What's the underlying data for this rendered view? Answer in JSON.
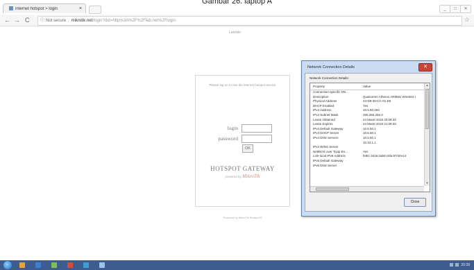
{
  "caption": "Gambar 26. laptop A",
  "browser": {
    "tab_title": "internet hotspot > login",
    "tab_close": "×",
    "back_icon": "←",
    "forward_icon": "→",
    "reload_icon": "C",
    "not_secure": "Not secure",
    "url_host": "mikrotik.net",
    "url_path": "/login?dst=http%3A%2F%2Flab.net%2Flogin",
    "star_icon": "☆",
    "win_min": "_",
    "win_max": "□",
    "win_close": "✕"
  },
  "hotspot": {
    "language_link": "Latviski",
    "notice": "Please log on to use the internet hotspot service",
    "login_label": "login",
    "password_label": "password",
    "ok_button": "OK",
    "brand": "HOTSPOT GATEWAY",
    "powered_by": "powered by",
    "mikrotik": "MikroTik",
    "footer": "Powered by MikroTik RouterOS"
  },
  "dialog": {
    "title": "Network Connection Details",
    "close_icon": "✕",
    "subtitle": "Network Connection Details:",
    "col_property": "Property",
    "col_value": "Value",
    "rows": [
      {
        "p": "Connection-specific DN...",
        "v": ""
      },
      {
        "p": "Description",
        "v": "Qualcomm Atheros AR956x Wireless I"
      },
      {
        "p": "Physical Address",
        "v": "44-D9-30-CC-01-E6"
      },
      {
        "p": "DHCP Enabled",
        "v": "Yes"
      },
      {
        "p": "IPv4 Address",
        "v": "10.5.50.253"
      },
      {
        "p": "IPv4 Subnet Mask",
        "v": "255.255.255.0"
      },
      {
        "p": "Lease Obtained",
        "v": "24 Maret 2018 20:09:33"
      },
      {
        "p": "Lease Expires",
        "v": "24 Maret 2018 21:09:33"
      },
      {
        "p": "IPv4 Default Gateway",
        "v": "10.5.50.1"
      },
      {
        "p": "IPv4 DHCP Server",
        "v": "10.5.50.1"
      },
      {
        "p": "IPv4 DNS Servers",
        "v": "10.5.50.1"
      },
      {
        "p": "",
        "v": "10.10.1.1"
      },
      {
        "p": "IPv4 WINS Server",
        "v": ""
      },
      {
        "p": "NetBIOS over Tcpip En...",
        "v": "Yes"
      },
      {
        "p": "Link-local IPv6 Address",
        "v": "fe80::3416:2ab9:c5fa:97c5%14"
      },
      {
        "p": "IPv6 Default Gateway",
        "v": ""
      },
      {
        "p": "IPv6 DNS Server",
        "v": ""
      }
    ],
    "close_button": "Close"
  },
  "taskbar": {
    "clock": "20:28",
    "app_colors": [
      "#e8a33c",
      "#3c7fd0",
      "#7fbf5a",
      "#d44c3c",
      "#3ca0d0",
      "#9ec3e8"
    ]
  }
}
